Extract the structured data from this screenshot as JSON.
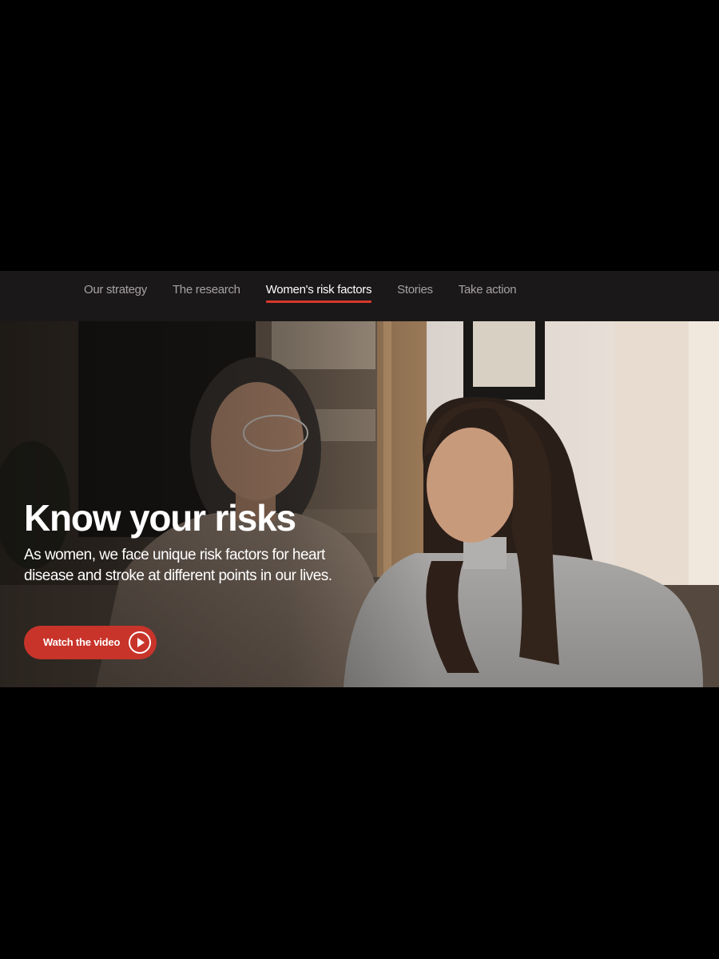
{
  "subnav": {
    "items": [
      {
        "label": "Our strategy",
        "active": false
      },
      {
        "label": "The research",
        "active": false
      },
      {
        "label": "Women's risk factors",
        "active": true
      },
      {
        "label": "Stories",
        "active": false
      },
      {
        "label": "Take action",
        "active": false
      }
    ]
  },
  "hero": {
    "title": "Know your risks",
    "subtitle": "As women, we face unique risk factors for heart disease and stroke at different points in our lives.",
    "cta_label": "Watch the video",
    "cta_icon": "play-circle-icon",
    "image_alt": "photo of two women sitting together on a couch"
  },
  "colors": {
    "accent": "#d6392b",
    "button": "#c8342a",
    "nav_background": "#1b1819",
    "page_background": "#000000"
  }
}
